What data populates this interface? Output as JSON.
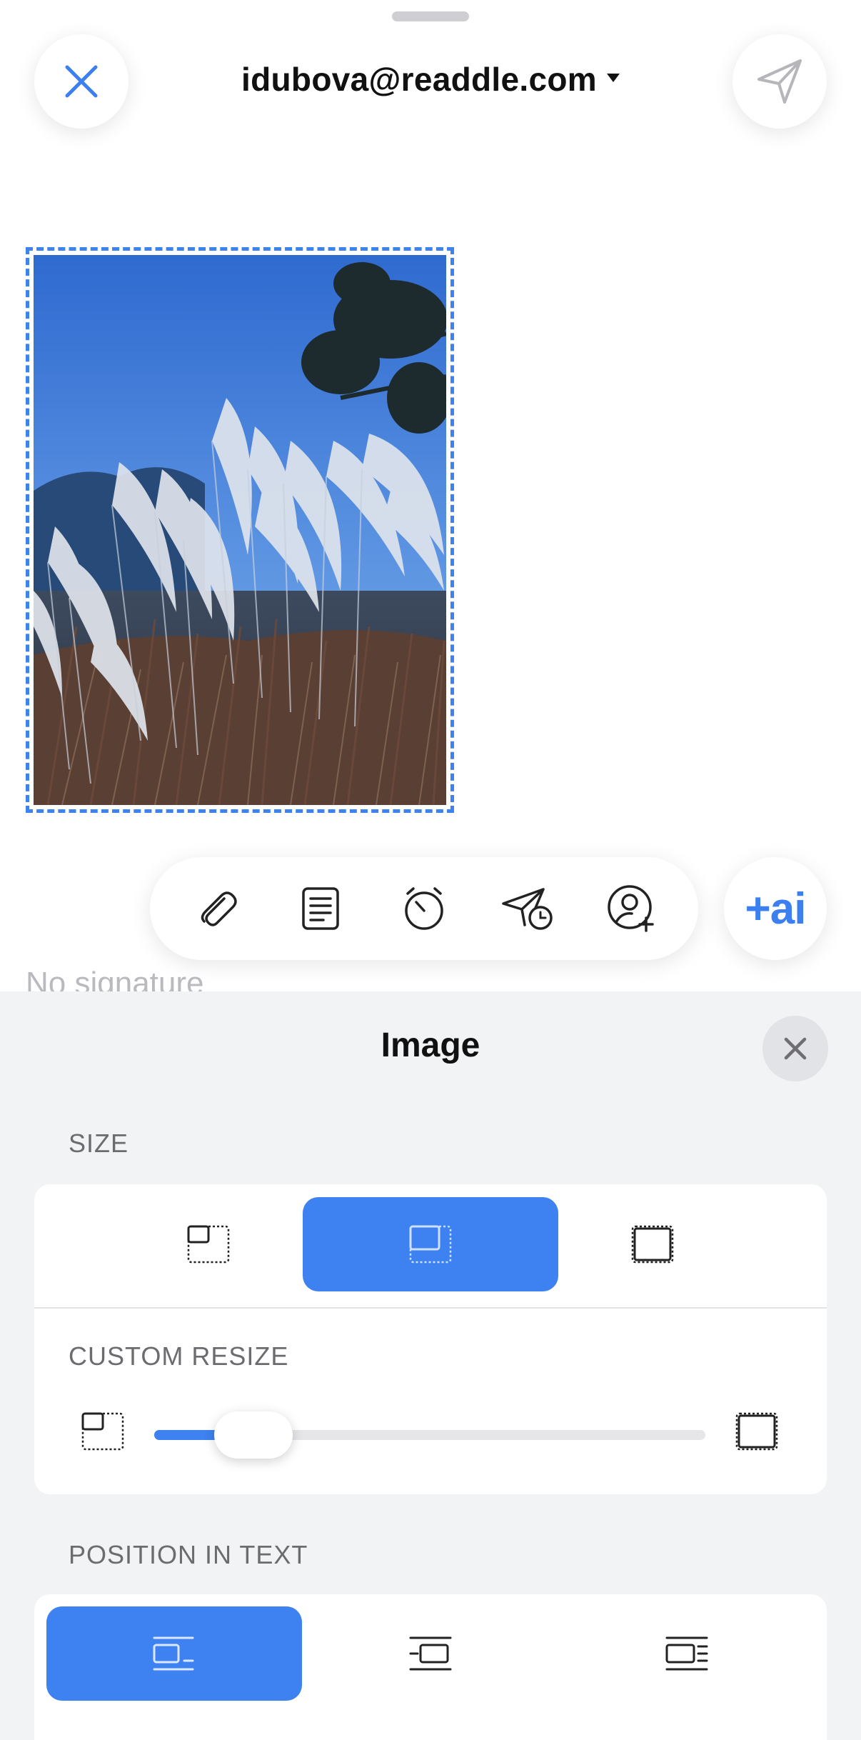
{
  "header": {
    "from_account": "idubova@readdle.com",
    "close_icon": "close-icon",
    "send_icon": "send-icon"
  },
  "body": {
    "signature_text": "No signature"
  },
  "toolbar": {
    "items": [
      {
        "name": "attachment",
        "icon": "paperclip-icon"
      },
      {
        "name": "template",
        "icon": "document-lines-icon"
      },
      {
        "name": "reminder",
        "icon": "alarm-clock-icon"
      },
      {
        "name": "send-later",
        "icon": "send-clock-icon"
      },
      {
        "name": "add-contact",
        "icon": "add-person-icon"
      }
    ],
    "ai_label": "+ai"
  },
  "image_sheet": {
    "title": "Image",
    "size_label": "SIZE",
    "size_options": [
      "small",
      "medium",
      "original"
    ],
    "size_selected": "medium",
    "custom_resize_label": "CUSTOM RESIZE",
    "custom_resize_value": 0.18,
    "position_label": "POSITION IN TEXT",
    "position_options": [
      "left",
      "center",
      "right"
    ],
    "position_selected": "left"
  },
  "colors": {
    "accent": "#3d82f0",
    "sheet_bg": "#f2f3f5"
  }
}
